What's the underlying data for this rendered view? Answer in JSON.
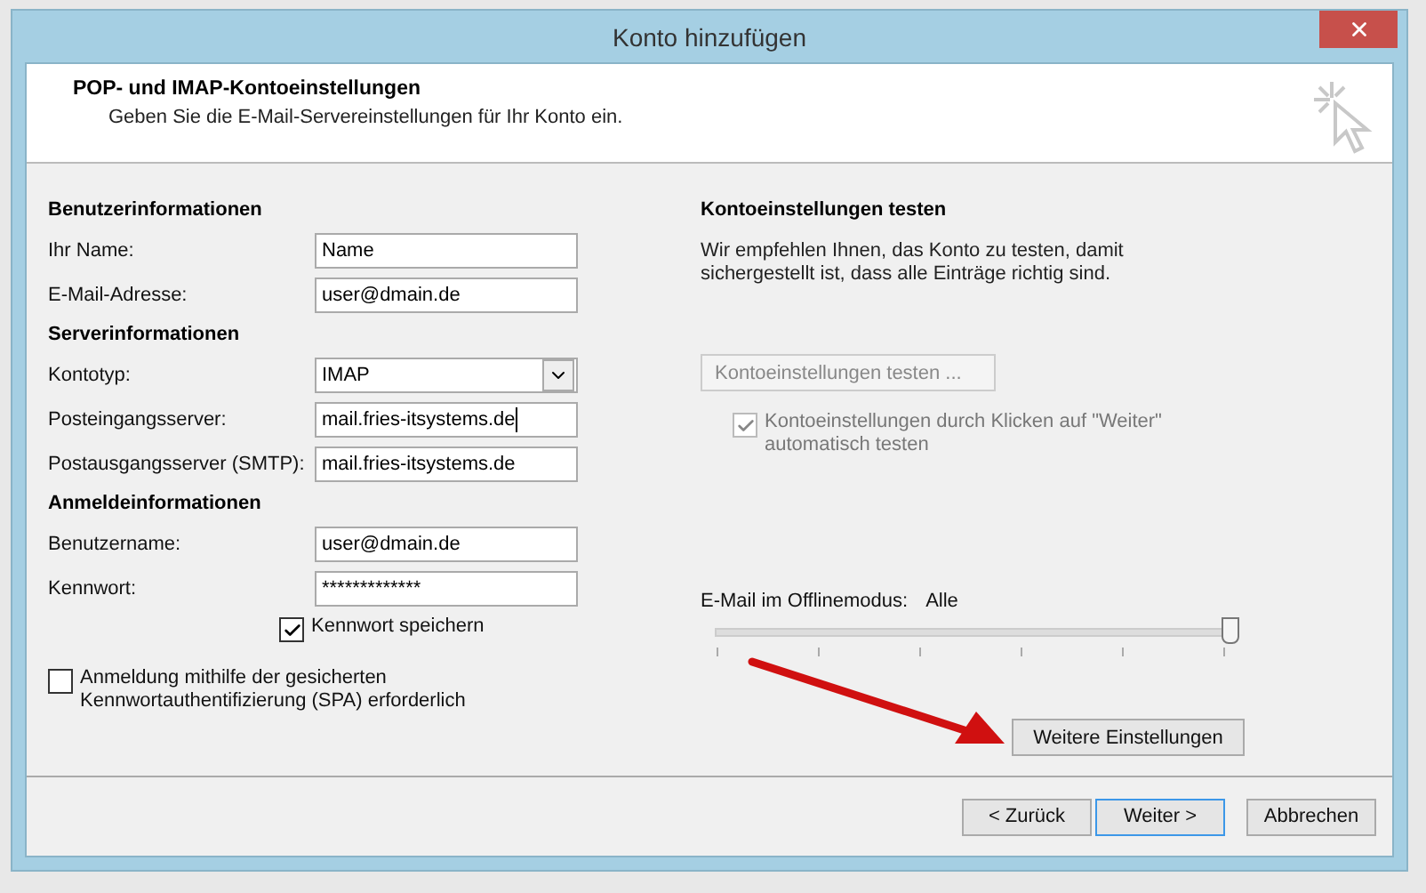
{
  "window": {
    "title": "Konto hinzufügen"
  },
  "header": {
    "title": "POP- und IMAP-Kontoeinstellungen",
    "subtitle": "Geben Sie die E-Mail-Servereinstellungen für Ihr Konto ein."
  },
  "sections": [
    {
      "heading": "Benutzerinformationen",
      "fields": [
        {
          "label": "Ihr Name:",
          "value": "Name",
          "kind": "text"
        },
        {
          "label": "E-Mail-Adresse:",
          "value": "user@dmain.de",
          "kind": "text"
        }
      ]
    },
    {
      "heading": "Serverinformationen",
      "fields": [
        {
          "label": "Kontotyp:",
          "value": "IMAP",
          "kind": "select"
        },
        {
          "label": "Posteingangsserver:",
          "value": "mail.fries-itsystems.de",
          "kind": "text",
          "focused": true
        },
        {
          "label": "Postausgangsserver (SMTP):",
          "value": "mail.fries-itsystems.de",
          "kind": "text"
        }
      ]
    },
    {
      "heading": "Anmeldeinformationen",
      "fields": [
        {
          "label": "Benutzername:",
          "value": "user@dmain.de",
          "kind": "text"
        },
        {
          "label": "Kennwort:",
          "value": "*************",
          "kind": "text"
        }
      ]
    }
  ],
  "save_password": {
    "label": "Kennwort speichern",
    "checked": true
  },
  "spa": {
    "label": "Anmeldung mithilfe der gesicherten Kennwortauthentifizierung (SPA) erforderlich",
    "checked": false
  },
  "test": {
    "heading": "Kontoeinstellungen testen",
    "description": "Wir empfehlen Ihnen, das Konto zu testen, damit sichergestellt ist, dass alle Einträge richtig sind.",
    "button": {
      "label": "Kontoeinstellungen testen ...",
      "disabled": true
    },
    "auto_test": {
      "label": "Kontoeinstellungen durch Klicken auf \"Weiter\" automatisch testen",
      "checked": true,
      "disabled": true
    }
  },
  "offline": {
    "label": "E-Mail im Offlinemodus:",
    "value": "Alle",
    "level": 1
  },
  "more_button": {
    "label": "Weitere Einstellungen"
  },
  "footer_buttons": [
    {
      "label": "< Zurück",
      "focused": false
    },
    {
      "label": "Weiter >",
      "focused": true
    },
    {
      "label": "Abbrechen",
      "focused": false
    }
  ]
}
